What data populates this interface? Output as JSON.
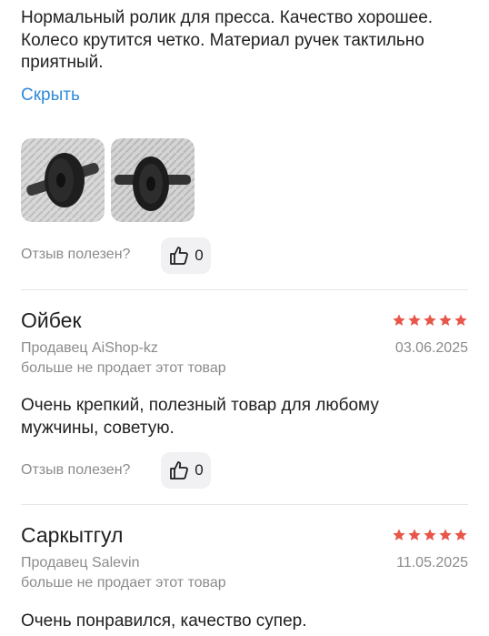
{
  "review_top": {
    "text": "Нормальный ролик для пресса. Качество хорошее. Колесо крутится четко. Материал ручек тактильно приятный.",
    "hide_label": "Скрыть",
    "helpful_label": "Отзыв полезен?",
    "like_count": "0"
  },
  "reviews": [
    {
      "author": "Ойбек",
      "rating": 5,
      "seller": "Продавец AiShop-kz",
      "date": "03.06.2025",
      "note": "больше не продает этот товар",
      "text": "Очень крепкий, полезный товар для любому мужчины, советую.",
      "helpful_label": "Отзыв полезен?",
      "like_count": "0"
    },
    {
      "author": "Саркытгул",
      "rating": 5,
      "seller": "Продавец Salevin",
      "date": "11.05.2025",
      "note": "больше не продает этот товар",
      "text": "Очень понравился, качество супер."
    }
  ],
  "colors": {
    "link": "#2f8ad8",
    "star": "#e8564a",
    "muted": "#8b8b8b"
  }
}
